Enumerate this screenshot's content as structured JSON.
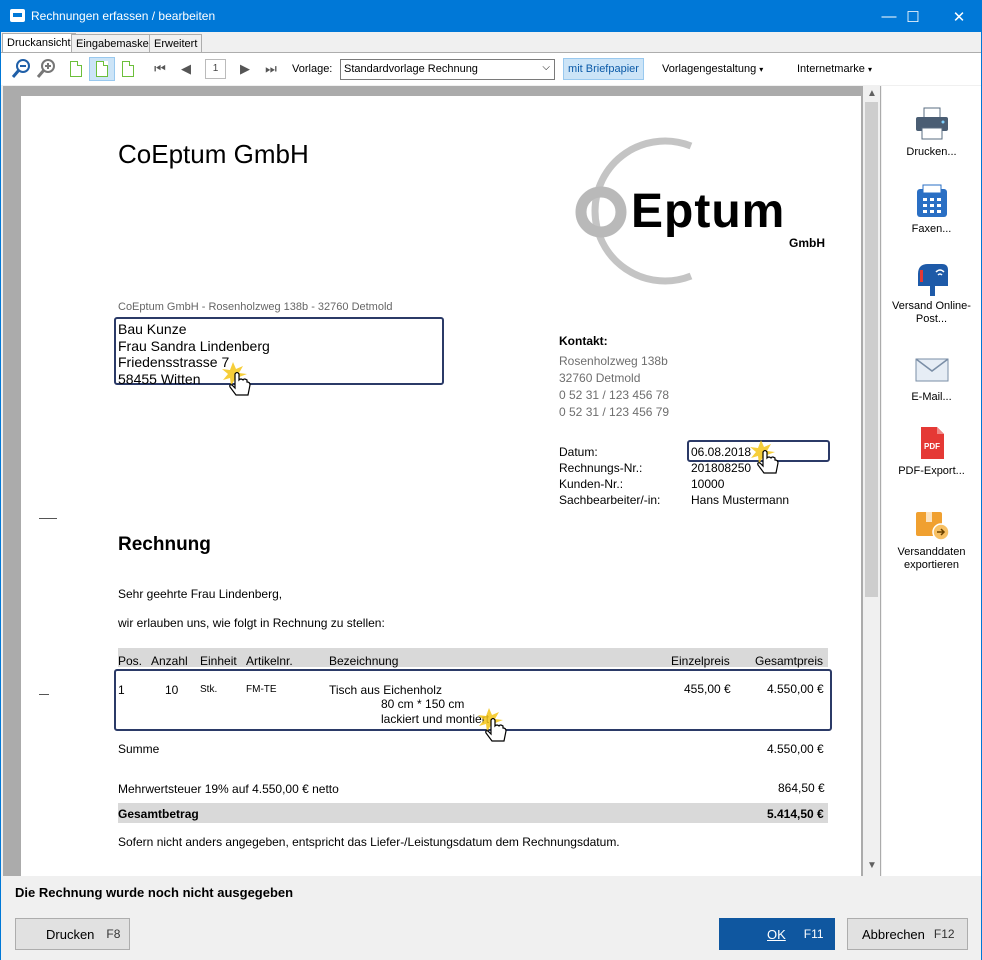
{
  "window": {
    "title": "Rechnungen erfassen / bearbeiten",
    "minimize": "—",
    "maximize": "☐",
    "close": "✕"
  },
  "tabs": [
    "Druckansicht",
    "Eingabemaske",
    "Erweitert"
  ],
  "toolbar": {
    "page_number": "1",
    "vorlage_label": "Vorlage:",
    "vorlage_value": "Standardvorlage Rechnung",
    "briefpapier_button": "mit Briefpapier",
    "vorlagengestaltung_menu": "Vorlagengestaltung",
    "internetmarke_menu": "Internetmarke"
  },
  "document": {
    "company": "CoEptum GmbH",
    "logo_text": "Eptum",
    "logo_sub": "GmbH",
    "sender_line": "CoEptum GmbH - Rosenholzweg 138b - 32760 Detmold",
    "recipient": [
      "Bau Kunze",
      "Frau Sandra Lindenberg",
      "Friedensstrasse 7",
      "58455 Witten"
    ],
    "kontakt_title": "Kontakt:",
    "kontakt": [
      "Rosenholzweg 138b",
      "32760 Detmold",
      "0 52 31 / 123 456 78",
      "0 52 31 / 123 456 79"
    ],
    "meta_labels": [
      "Datum:",
      "Rechnungs-Nr.:",
      "Kunden-Nr.:",
      "Sachbearbeiter/-in:"
    ],
    "meta_values": [
      "06.08.2018",
      "201808250",
      "10000",
      "Hans Mustermann"
    ],
    "heading": "Rechnung",
    "salutation": "Sehr geehrte Frau Lindenberg,",
    "intro": "wir erlauben uns, wie folgt in Rechnung zu stellen:",
    "columns": [
      "Pos.",
      "Anzahl",
      "Einheit",
      "Artikelnr.",
      "Bezeichnung",
      "Einzelpreis",
      "Gesamtpreis"
    ],
    "row": {
      "pos": "1",
      "anzahl": "10",
      "einheit": "Stk.",
      "artikelnr": "FM-TE",
      "bezeichnung": "Tisch aus Eichenholz",
      "detail1": "80 cm * 150 cm",
      "detail2": "lackiert und montiert",
      "einzelpreis": "455,00 €",
      "gesamtpreis": "4.550,00 €"
    },
    "summe_label": "Summe",
    "summe_value": "4.550,00 €",
    "mwst_label": "Mehrwertsteuer 19% auf 4.550,00 € netto",
    "mwst_value": "864,50 €",
    "gesamt_label": "Gesamtbetrag",
    "gesamt_value": "5.414,50 €",
    "footer_note": "Sofern nicht anders angegeben, entspricht das Liefer-/Leistungsdatum dem Rechnungsdatum."
  },
  "side_actions": [
    {
      "label": "Drucken...",
      "icon": "printer-icon"
    },
    {
      "label": "Faxen...",
      "icon": "fax-icon"
    },
    {
      "label": "Versand Online-Post...",
      "icon": "mailbox-icon"
    },
    {
      "label": "E-Mail...",
      "icon": "envelope-icon"
    },
    {
      "label": "PDF-Export...",
      "icon": "pdf-icon"
    },
    {
      "label": "Versanddaten exportieren",
      "icon": "package-export-icon"
    }
  ],
  "status": "Die Rechnung wurde noch nicht ausgegeben",
  "buttons": {
    "drucken": "Drucken",
    "drucken_key": "F8",
    "ok": "OK",
    "ok_key": "F11",
    "abbrechen": "Abbrechen",
    "abbrechen_key": "F12"
  },
  "colors": {
    "titlebar": "#0078d7",
    "primary_button": "#0f57a0",
    "highlight_box": "#2b3a67"
  }
}
